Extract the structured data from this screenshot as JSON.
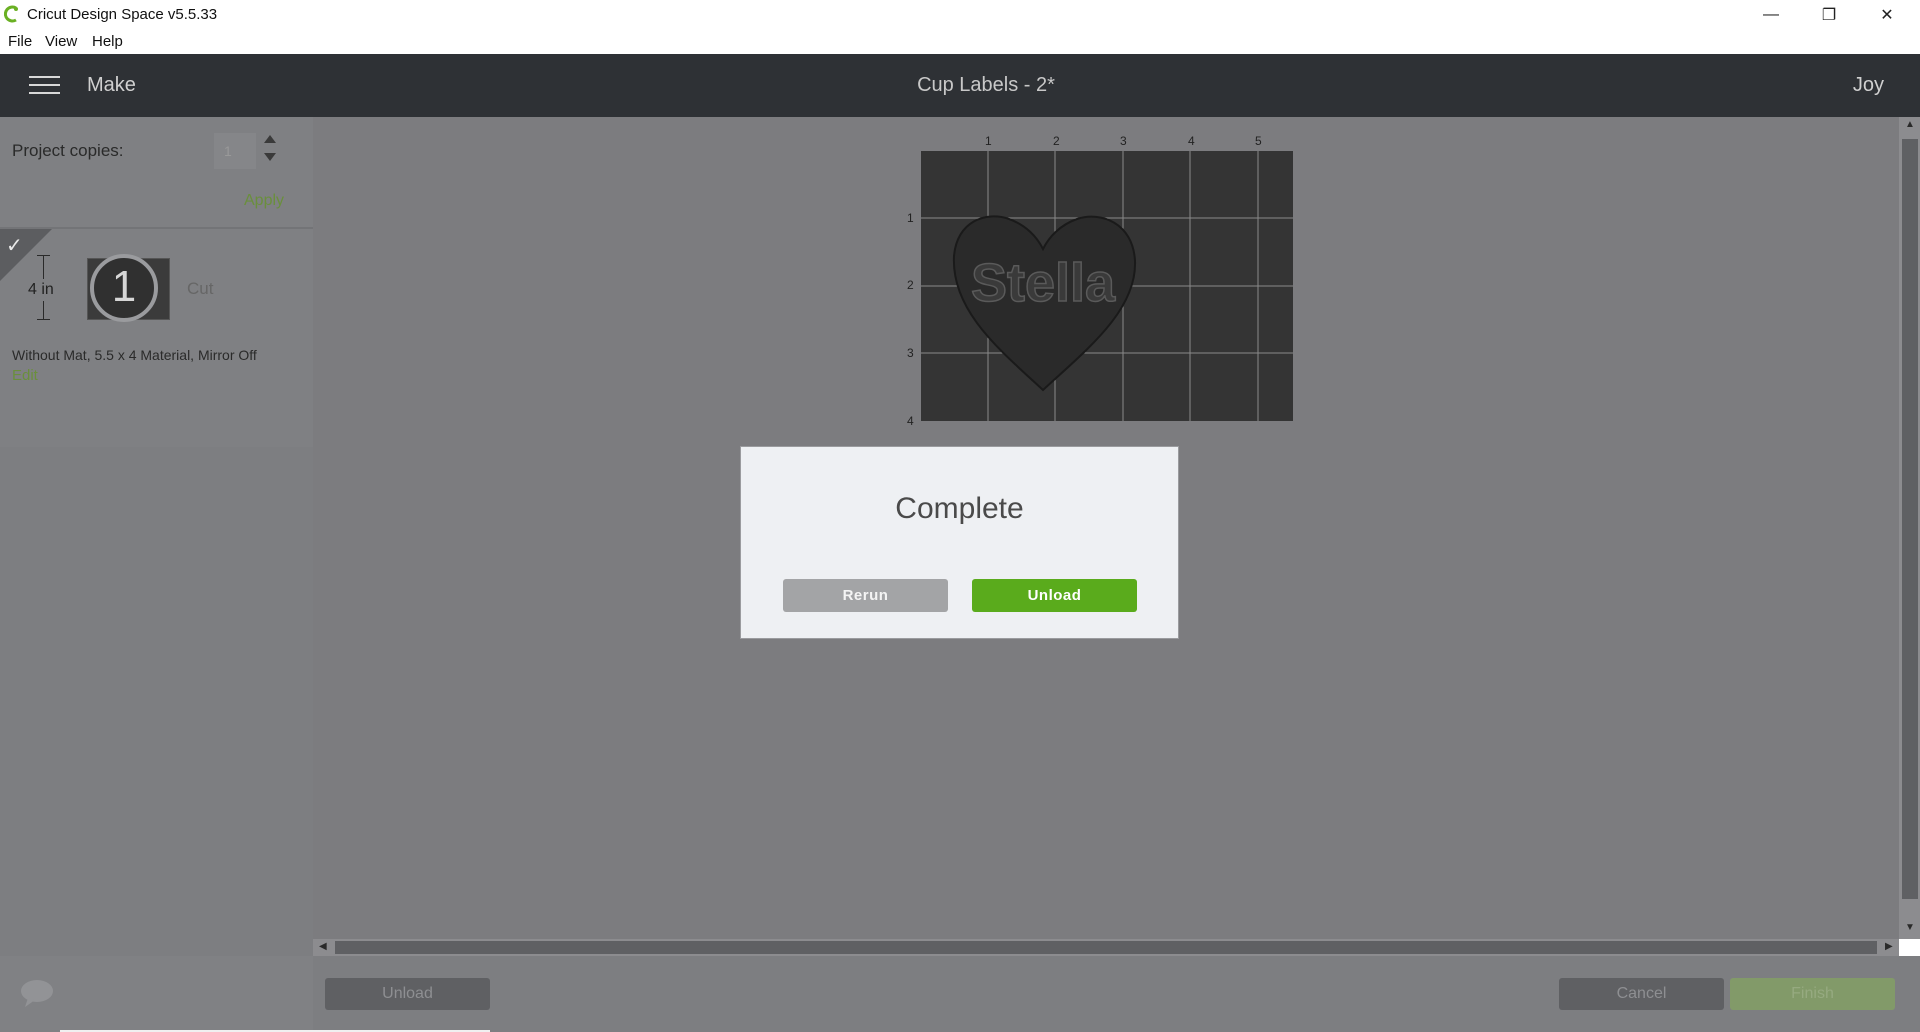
{
  "window": {
    "title": "Cricut Design Space  v5.5.33",
    "controls": {
      "minimize": "—",
      "restore": "❐",
      "close": "✕"
    }
  },
  "menu": [
    "File",
    "View",
    "Help"
  ],
  "header": {
    "section": "Make",
    "project_title": "Cup Labels - 2*",
    "user": "Joy"
  },
  "sidebar": {
    "copies_label": "Project copies:",
    "copies_value": "1",
    "apply_label": "Apply",
    "mat": {
      "dimension": "4 in",
      "number": "1",
      "status": "Cut",
      "info": "Without Mat, 5.5 x 4 Material, Mirror Off",
      "edit_label": "Edit"
    }
  },
  "mat_preview": {
    "ruler_x": [
      "1",
      "2",
      "3",
      "4",
      "5"
    ],
    "ruler_y": [
      "1",
      "2",
      "3",
      "4"
    ],
    "design_text": "Stella"
  },
  "dialog": {
    "title": "Complete",
    "rerun_label": "Rerun",
    "unload_label": "Unload"
  },
  "footer": {
    "unload_label": "Unload",
    "cancel_label": "Cancel",
    "finish_label": "Finish"
  },
  "colors": {
    "accent_green": "#6ab023",
    "header_bg": "#2e3135",
    "overlay_gray": "#7c7c7f"
  }
}
